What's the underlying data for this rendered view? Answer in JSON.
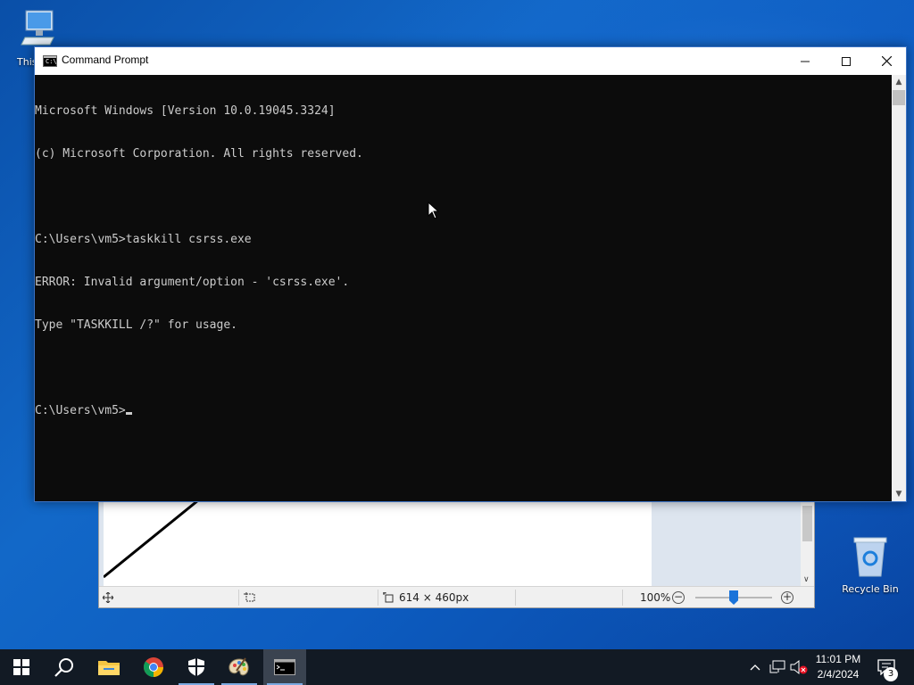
{
  "desktop": {
    "icons": [
      {
        "label": "This PC",
        "visible_label": "This"
      },
      {
        "label": "Recycle Bin"
      }
    ]
  },
  "paint": {
    "image_size": "614 × 460px",
    "zoom": "100%",
    "zoom_fraction": 0.5
  },
  "cmd": {
    "title": "Command Prompt",
    "lines": [
      "Microsoft Windows [Version 10.0.19045.3324]",
      "(c) Microsoft Corporation. All rights reserved.",
      "",
      "C:\\Users\\vm5>taskkill csrss.exe",
      "ERROR: Invalid argument/option - 'csrss.exe'.",
      "Type \"TASKKILL /?\" for usage.",
      "",
      "C:\\Users\\vm5>"
    ],
    "icon_text": "C:\\"
  },
  "taskbar": {
    "apps": [
      {
        "name": "start",
        "icon": "windows-logo-icon"
      },
      {
        "name": "search",
        "icon": "search-icon"
      },
      {
        "name": "file-explorer",
        "icon": "folder-icon"
      },
      {
        "name": "chrome",
        "icon": "chrome-icon"
      },
      {
        "name": "security",
        "icon": "shield-icon"
      },
      {
        "name": "paint",
        "icon": "palette-icon"
      },
      {
        "name": "command-prompt",
        "icon": "terminal-icon"
      }
    ],
    "clock_time": "11:01 PM",
    "clock_date": "2/4/2024",
    "notification_count": "3"
  },
  "colors": {
    "desktop_blue": "#0d5cc0",
    "console_bg": "#0c0c0c",
    "console_fg": "#cccccc",
    "taskbar": "#121a24",
    "accent": "#1a73d9"
  }
}
